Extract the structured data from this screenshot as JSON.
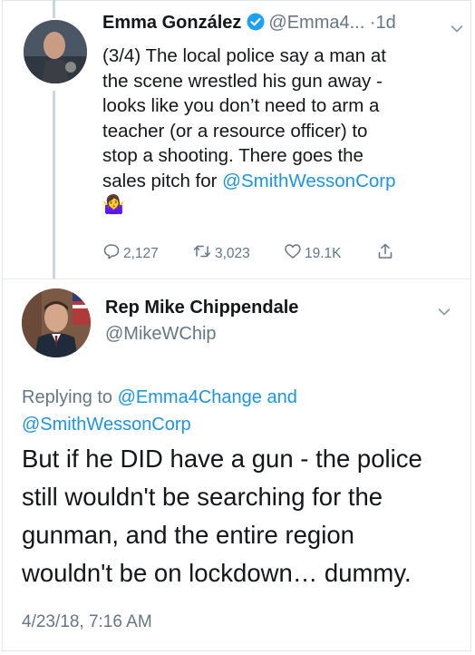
{
  "tweet1": {
    "name": "Emma González",
    "handle": "@Emma4...",
    "dot": "·",
    "time": "1d",
    "lines": [
      "(3/4) The local police say a man at",
      "the scene wrestled his gun away -",
      "looks like you don’t need to arm a",
      "teacher (or a resource officer) to",
      "stop a shooting. There goes the"
    ],
    "line6_prefix": "sales pitch for ",
    "mention": "@SmithWessonCorp",
    "emoji": "🤷‍♀️",
    "replies": "2,127",
    "retweets": "3,023",
    "likes": "19.1K"
  },
  "tweet2": {
    "name": "Rep Mike Chippendale",
    "handle": "@MikeWChip",
    "replying_prefix": "Replying to ",
    "reply_mention1": "@Emma4Change",
    "reply_and": " and",
    "reply_mention2": "@SmithWessonCorp",
    "lines": [
      "But if he DID have a gun - the police",
      "still wouldn't be searching for the",
      "gunman, and the entire region",
      "wouldn't be on lockdown… dummy."
    ],
    "timestamp": "4/23/18, 7:16 AM"
  },
  "colors": {
    "link": "#1b95e0",
    "secondary": "#657786",
    "verified": "#1da1f2"
  },
  "icons": [
    "verified-badge-icon",
    "chevron-down-icon",
    "reply-icon",
    "retweet-icon",
    "like-icon",
    "share-icon"
  ]
}
